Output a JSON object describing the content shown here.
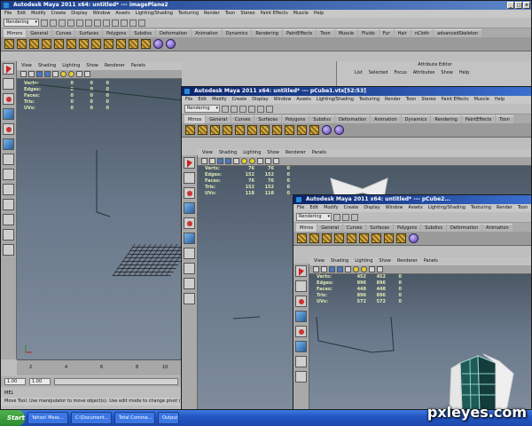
{
  "menus": [
    "File",
    "Edit",
    "Modify",
    "Create",
    "Display",
    "Window",
    "Assets",
    "Lighting/Shading",
    "Texturing",
    "Render",
    "Toon",
    "Stereo",
    "Paint Effects",
    "Muscle",
    "Help"
  ],
  "windows": [
    {
      "title": "Autodesk Maya 2011 x64: untitled*   ---   imagePlane2",
      "mode": "Rendering",
      "shelf_tabs": [
        "Mirrors",
        "General",
        "Curves",
        "Surfaces",
        "Polygons",
        "Subdivs",
        "Deformation",
        "Animation",
        "Dynamics",
        "Rendering",
        "PaintEffects",
        "Toon",
        "Muscle",
        "Fluids",
        "Fur",
        "Hair",
        "nCloth",
        "advancedSkeleton"
      ],
      "hud": {
        "labels": [
          "Verts:",
          "Edges:",
          "Faces:",
          "Tris:",
          "UVs:"
        ],
        "col1": [
          "0",
          "0",
          "0",
          "0",
          "0"
        ],
        "col2": [
          "0",
          "0",
          "0",
          "0",
          "0"
        ],
        "col3": [
          "0",
          "0",
          "0",
          "0",
          "0"
        ]
      }
    },
    {
      "title": "Autodesk Maya 2011 x64: untitled*   ---   pCube1.vtx[52:53]",
      "mode": "Rendering",
      "shelf_tabs": [
        "Mirros",
        "General",
        "Curves",
        "Surfaces",
        "Polygons",
        "Subdivs",
        "Deformation",
        "Animation",
        "Dynamics",
        "Rendering",
        "PaintEffects",
        "Toon"
      ],
      "hud": {
        "labels": [
          "Verts:",
          "Edges:",
          "Faces:",
          "Tris:",
          "UVs:"
        ],
        "col1": [
          "76",
          "152",
          "76",
          "152",
          "118"
        ],
        "col2": [
          "76",
          "152",
          "76",
          "152",
          "118"
        ],
        "col3": [
          "0",
          "0",
          "0",
          "0",
          "0"
        ]
      }
    },
    {
      "title": "Autodesk Maya 2011 x64: untitled*   ---   pCube2...",
      "mode": "Rendering",
      "shelf_tabs": [
        "Mirros",
        "General",
        "Curves",
        "Surfaces",
        "Polygons",
        "Subdivs",
        "Deformation",
        "Animation"
      ],
      "hud": {
        "labels": [
          "Verts:",
          "Edges:",
          "Faces:",
          "Tris:",
          "UVs:"
        ],
        "col1": [
          "452",
          "896",
          "448",
          "896",
          "572"
        ],
        "col2": [
          "452",
          "896",
          "448",
          "896",
          "572"
        ],
        "col3": [
          "0",
          "0",
          "0",
          "0",
          "0"
        ]
      }
    }
  ],
  "panel_menu": [
    "View",
    "Shading",
    "Lighting",
    "Show",
    "Renderer",
    "Panels"
  ],
  "attr_editor": {
    "title": "Attribute Editor",
    "menu": [
      "List",
      "Selected",
      "Focus",
      "Attributes",
      "Show",
      "Help"
    ]
  },
  "timeline": {
    "ticks": [
      "2",
      "4",
      "6",
      "8",
      "10"
    ],
    "start": "1.00",
    "end": "1.00"
  },
  "mel": {
    "label": "MEL"
  },
  "help_line": "Move Tool: Use manipulator to move object(s). Use edit mode to change pivot (INSERT). Ct...",
  "taskbar": {
    "start": "Start",
    "items": [
      "Yahoo! Mess...",
      "C:\\Document...",
      "Total Comma...",
      "Output"
    ]
  },
  "watermark": "pxleyes.com",
  "colors": {
    "title_active": "#0a246a",
    "hud_text": "#dfe8b0",
    "viewport_top": "#4b5866",
    "viewport_bottom": "#7e8c9c"
  }
}
